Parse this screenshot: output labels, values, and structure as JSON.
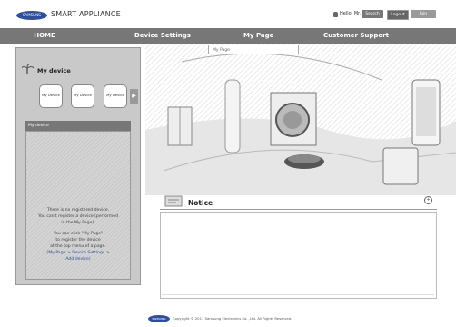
{
  "header": {
    "logo_text": "SAMSUNG",
    "title": "SMART APPLIANCE",
    "greeting": "Hello, Mr.",
    "buttons": {
      "search": "Search",
      "logout": "Logout",
      "join": "Join"
    }
  },
  "nav": {
    "items": [
      "HOME",
      "Device Settings",
      "My Page",
      "Customer Support"
    ],
    "dropdown": "My Page"
  },
  "sidebar": {
    "title": "My device",
    "devices": [
      "My Device",
      "My Device",
      "My Device"
    ],
    "arrow": "▶",
    "panel_header": "My device",
    "messages": [
      "There is no registered device.",
      "You can't register a device (performed",
      "in the My Page).",
      "You can click \"My Page\"",
      "to register the device",
      "at the top menu of a page.",
      "(My Page > Device Settings >",
      "Add device)"
    ]
  },
  "notice": {
    "title": "Notice",
    "more": "+"
  },
  "footer": {
    "logo_text": "SAMSUNG",
    "copyright": "Copyright © 2011 Samsung Electronics Co., Ltd. All Rights Reserved."
  },
  "colors": {
    "nav": "#777777",
    "brand": "#2f4f9a",
    "sidebar": "#c9c9c9"
  }
}
